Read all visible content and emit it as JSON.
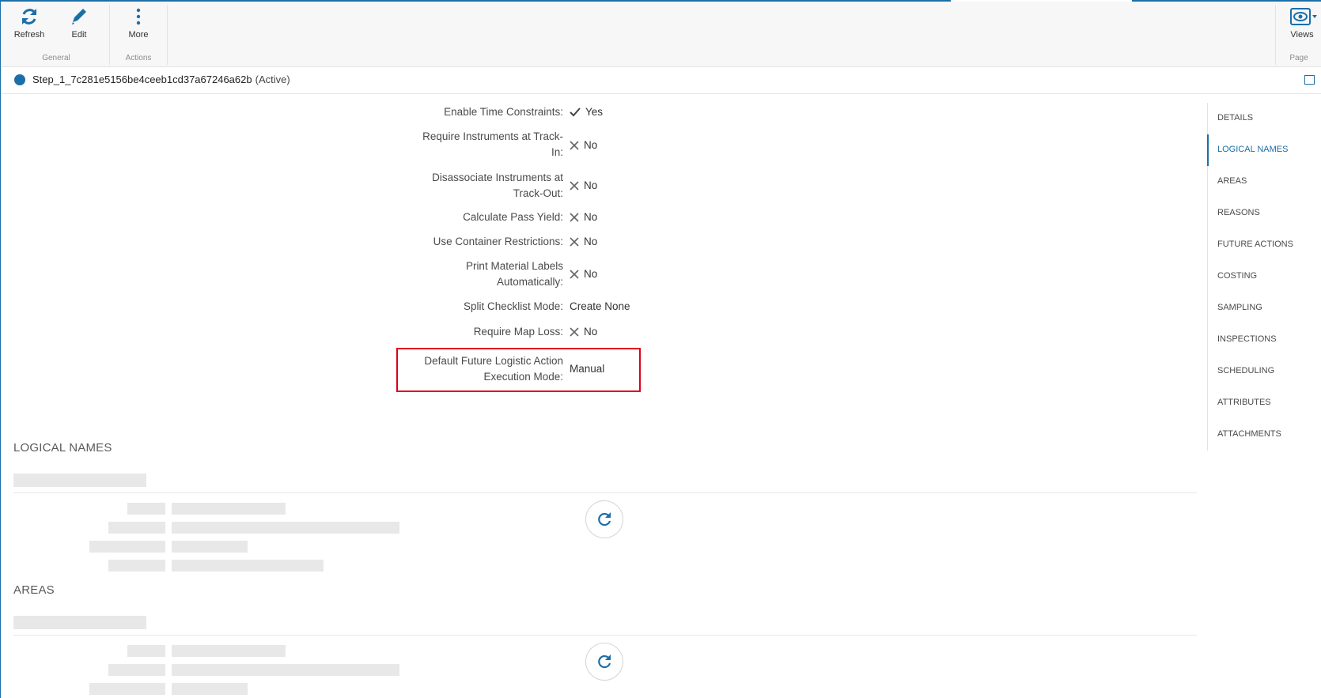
{
  "ribbon": {
    "buttons": [
      {
        "label": "Refresh",
        "icon": "refresh-icon"
      },
      {
        "label": "Edit",
        "icon": "pencil-icon"
      },
      {
        "label": "More",
        "icon": "more-vertical-icon"
      },
      {
        "label": "Views",
        "icon": "eye-icon"
      }
    ],
    "groups": {
      "general": "General",
      "actions": "Actions",
      "page": "Page"
    }
  },
  "header": {
    "title": "Step_1_7c281e5156be4ceeb1cd37a67246a62b",
    "status": "(Active)"
  },
  "properties": [
    {
      "label": "Enable Time Constraints:",
      "value": "Yes",
      "icon": "check-icon"
    },
    {
      "label_line1": "Require Instruments at Track-",
      "label_line2": "In:",
      "value": "No",
      "icon": "x-icon"
    },
    {
      "label_line1": "Disassociate Instruments at",
      "label_line2": "Track-Out:",
      "value": "No",
      "icon": "x-icon"
    },
    {
      "label": "Calculate Pass Yield:",
      "value": "No",
      "icon": "x-icon"
    },
    {
      "label": "Use Container Restrictions:",
      "value": "No",
      "icon": "x-icon"
    },
    {
      "label_line1": "Print Material Labels",
      "label_line2": "Automatically:",
      "value": "No",
      "icon": "x-icon"
    },
    {
      "label": "Split Checklist Mode:",
      "value": "Create None"
    },
    {
      "label": "Require Map Loss:",
      "value": "No",
      "icon": "x-icon"
    },
    {
      "label_line1": "Default Future Logistic Action",
      "label_line2": "Execution Mode:",
      "value": "Manual"
    }
  ],
  "nav": {
    "items": [
      "DETAILS",
      "LOGICAL NAMES",
      "AREAS",
      "REASONS",
      "FUTURE ACTIONS",
      "COSTING",
      "SAMPLING",
      "INSPECTIONS",
      "SCHEDULING",
      "ATTRIBUTES",
      "ATTACHMENTS"
    ],
    "active": "LOGICAL NAMES"
  },
  "sections": {
    "logical_names": "LOGICAL NAMES",
    "areas": "AREAS"
  },
  "colors": {
    "accent": "#1b6fa8",
    "highlight": "#e0001b"
  }
}
